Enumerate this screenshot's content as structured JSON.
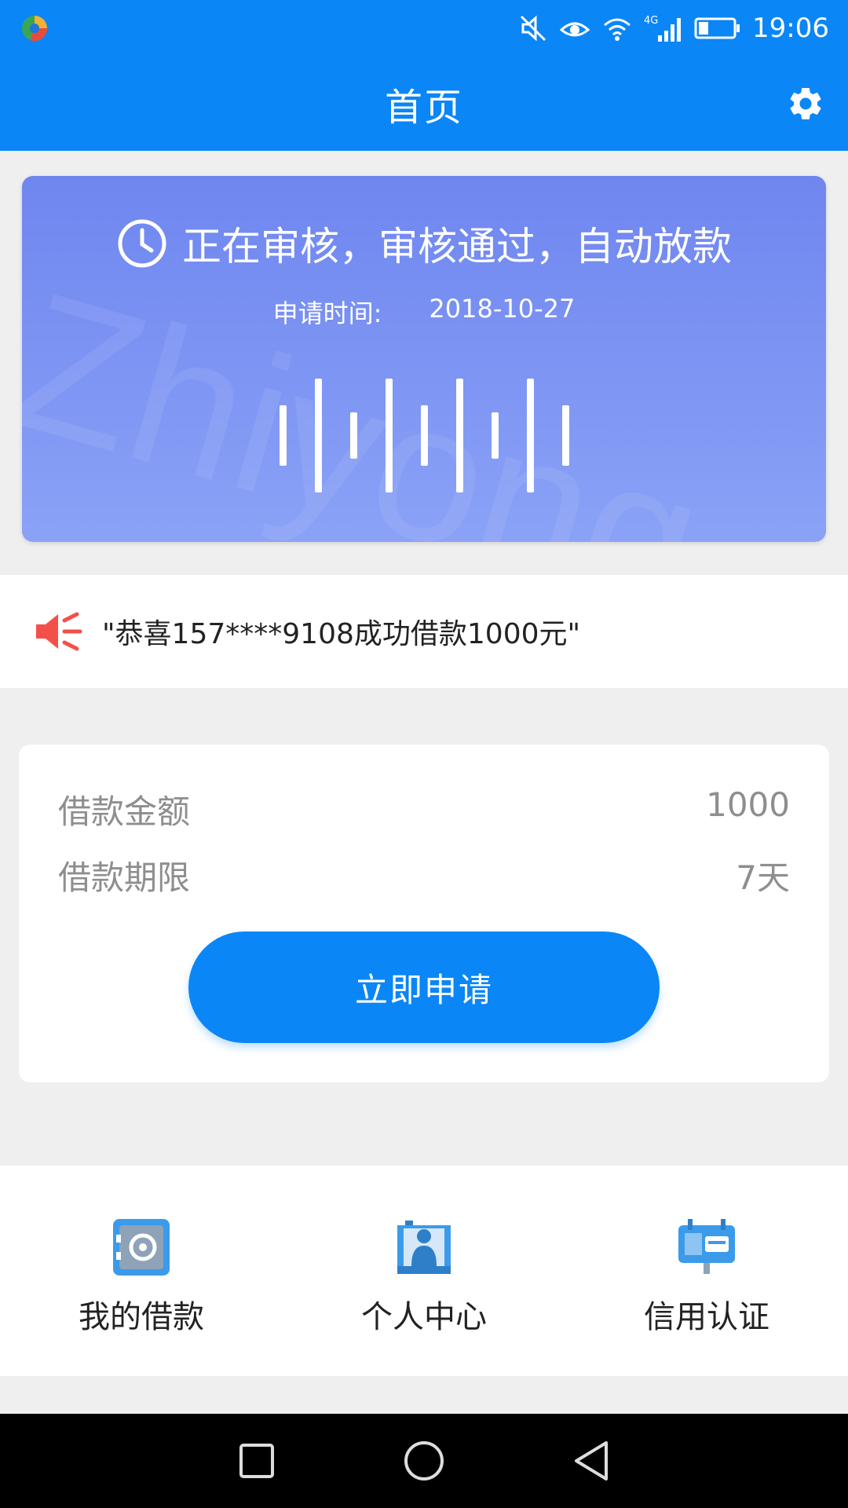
{
  "status_bar": {
    "time": "19:06",
    "network": "4G"
  },
  "header": {
    "title": "首页"
  },
  "banner": {
    "status_text": "正在审核，审核通过，自动放款",
    "time_label": "申请时间:",
    "time_value": "2018-10-27",
    "watermark": "Zhiyong",
    "wave_levels": [
      0.45,
      0.85,
      0.35,
      0.85,
      0.45,
      0.85,
      0.35,
      0.85,
      0.45
    ]
  },
  "notice": {
    "text": "\"恭喜157****9108成功借款1000元\""
  },
  "loan": {
    "amount_label": "借款金额",
    "amount_value": "1000",
    "term_label": "借款期限",
    "term_value": "7天",
    "apply_label": "立即申请"
  },
  "shortcuts": [
    {
      "label": "我的借款",
      "icon": "safe-icon"
    },
    {
      "label": "个人中心",
      "icon": "person-icon"
    },
    {
      "label": "信用认证",
      "icon": "credit-card-icon"
    }
  ],
  "colors": {
    "primary": "#0a86f6",
    "banner_top": "#6f86f0",
    "banner_bottom": "#8aa2f6",
    "speaker": "#f4504a"
  }
}
